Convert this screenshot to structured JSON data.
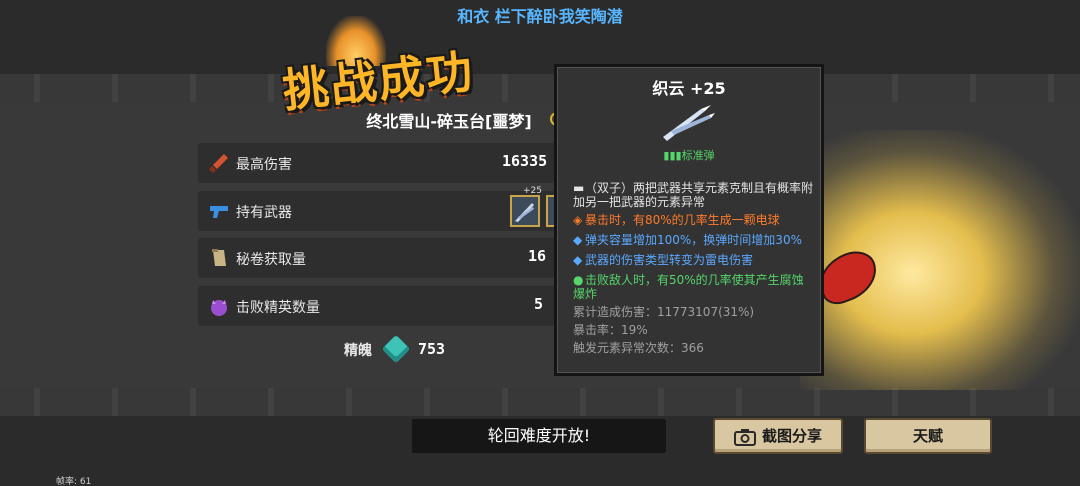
{
  "header": {
    "player_name": "和衣 栏下醉卧我笑陶潜"
  },
  "result": {
    "title": "挑战成功",
    "stage": "终北雪山-碎玉台[噩梦]"
  },
  "stats": [
    {
      "icon": "sword-icon",
      "label": "最高伤害",
      "value": "16335"
    },
    {
      "icon": "gun-icon",
      "label": "持有武器",
      "value": ""
    },
    {
      "icon": "scroll-icon",
      "label": "秘卷获取量",
      "value": "16"
    },
    {
      "icon": "demon-icon",
      "label": "击败精英数量",
      "value": "5"
    }
  ],
  "weapons": {
    "slot1_level": "+25"
  },
  "soul": {
    "label": "精魄",
    "value": "753"
  },
  "tooltip": {
    "title": "织云 +25",
    "type": "标准弹",
    "lines": [
      {
        "color": "white",
        "mark": "▬",
        "text": "（双子）两把武器共享元素克制且有概率附加另一把武器的元素异常"
      },
      {
        "color": "orange",
        "mark": "◈",
        "text": "暴击时，有80%的几率生成一颗电球"
      },
      {
        "color": "blue",
        "mark": "◆",
        "text": "弹夹容量增加100%，换弹时间增加30%"
      },
      {
        "color": "blue",
        "mark": "◆",
        "text": "武器的伤害类型转变为雷电伤害"
      },
      {
        "color": "green",
        "mark": "●",
        "text": "击败敌人时，有50%的几率使其产生腐蚀爆炸"
      }
    ],
    "stats": [
      "累计造成伤害：11773107(31%)",
      "暴击率：19%",
      "触发元素异常次数：366"
    ]
  },
  "notice": "轮回难度开放!",
  "buttons": {
    "screenshot_share": "截图分享",
    "talent": "天赋"
  },
  "fps": "帧率: 61"
}
